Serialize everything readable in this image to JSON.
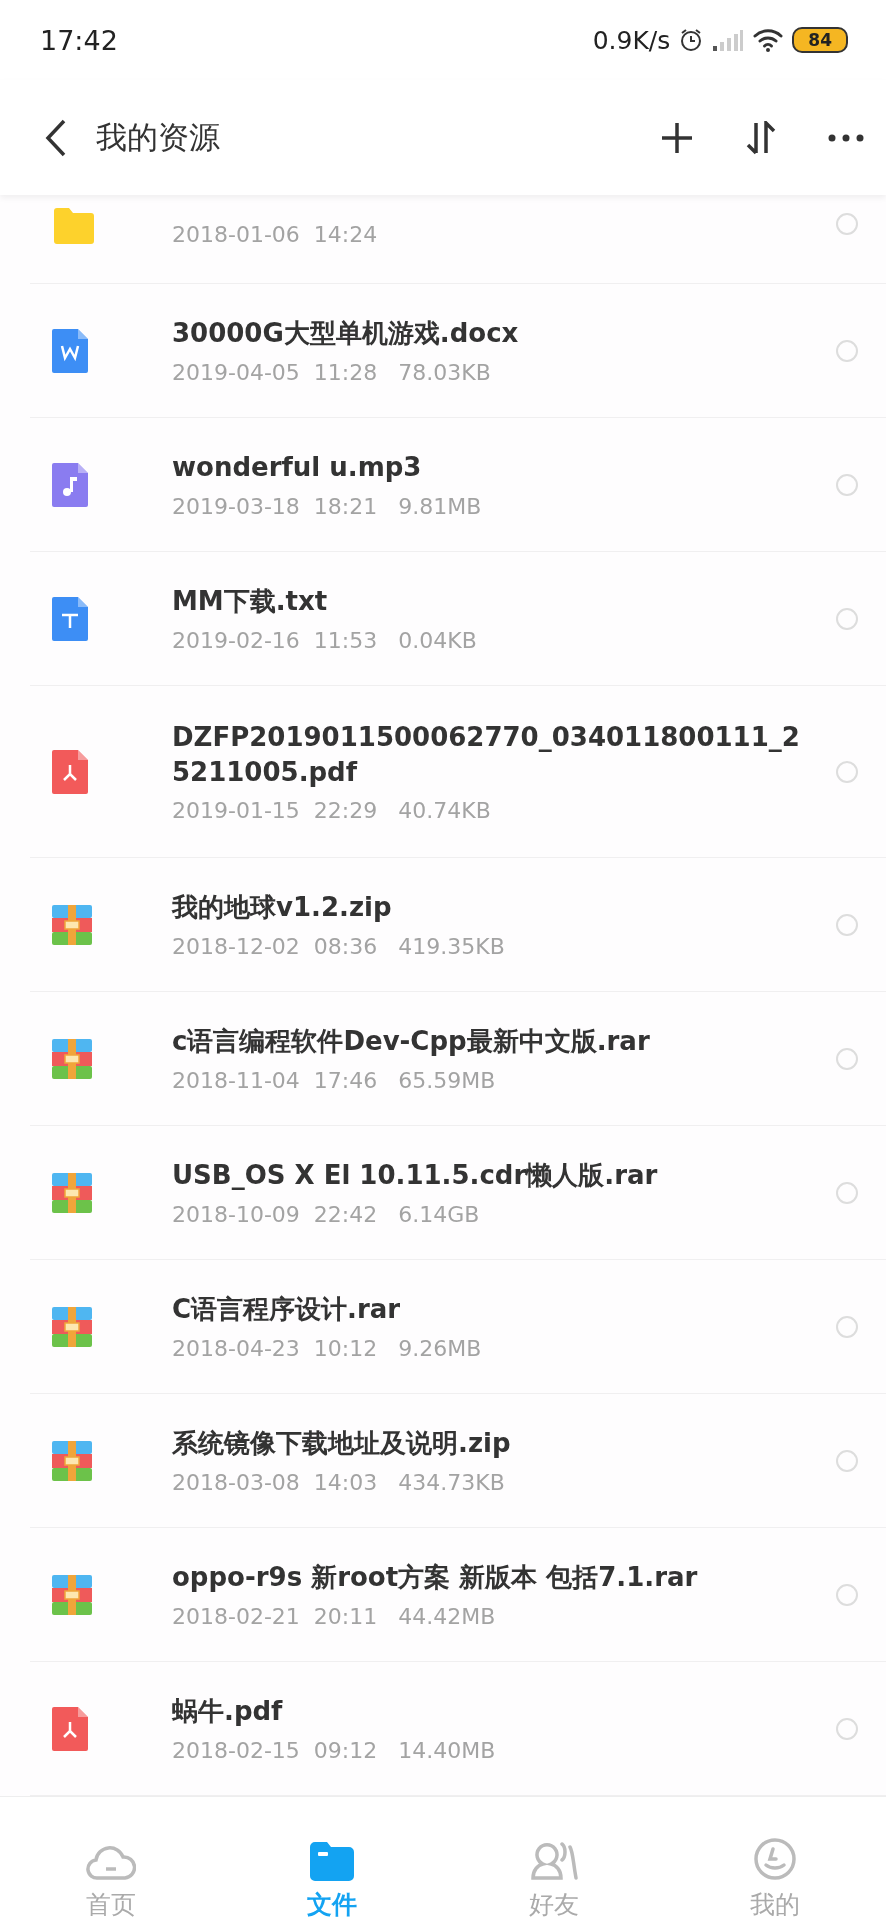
{
  "status_bar": {
    "time": "17:42",
    "speed": "0.9K/s",
    "battery": "84"
  },
  "header": {
    "title": "我的资源"
  },
  "files": [
    {
      "kind": "folder",
      "meta": "2018-01-06  14:24",
      "selected": false
    },
    {
      "kind": "word",
      "name": "30000G大型单机游戏.docx",
      "meta": "2019-04-05  11:28   78.03KB",
      "selected": false
    },
    {
      "kind": "audio",
      "name": "wonderful u.mp3",
      "meta": "2019-03-18  18:21   9.81MB",
      "selected": false
    },
    {
      "kind": "text",
      "name": "MM下载.txt",
      "meta": "2019-02-16  11:53   0.04KB",
      "selected": false
    },
    {
      "kind": "pdf",
      "name": "DZFP2019011500062770_034011800111_25211005.pdf",
      "meta": "2019-01-15  22:29   40.74KB",
      "selected": false
    },
    {
      "kind": "archive",
      "name": "我的地球v1.2.zip",
      "meta": "2018-12-02  08:36   419.35KB",
      "selected": false
    },
    {
      "kind": "archive",
      "name": "c语言编程软件Dev-Cpp最新中文版.rar",
      "meta": "2018-11-04  17:46   65.59MB",
      "selected": false
    },
    {
      "kind": "archive",
      "name": "USB_OS X El 10.11.5.cdr懒人版.rar",
      "meta": "2018-10-09  22:42   6.14GB",
      "selected": false
    },
    {
      "kind": "archive",
      "name": "C语言程序设计.rar",
      "meta": "2018-04-23  10:12   9.26MB",
      "selected": false
    },
    {
      "kind": "archive",
      "name": "系统镜像下载地址及说明.zip",
      "meta": "2018-03-08  14:03   434.73KB",
      "selected": false
    },
    {
      "kind": "archive",
      "name": "oppo-r9s 新root方案 新版本 包括7.1.rar",
      "meta": "2018-02-21  20:11   44.42MB",
      "selected": false
    },
    {
      "kind": "pdf",
      "name": "蜗牛.pdf",
      "meta": "2018-02-15  09:12   14.40MB",
      "selected": false
    }
  ],
  "nav": [
    {
      "kind": "cloud",
      "label": "首页",
      "selected": false
    },
    {
      "kind": "folder",
      "label": "文件",
      "selected": true
    },
    {
      "kind": "friends",
      "label": "好友",
      "selected": false
    },
    {
      "kind": "me",
      "label": "我的",
      "selected": false
    }
  ]
}
